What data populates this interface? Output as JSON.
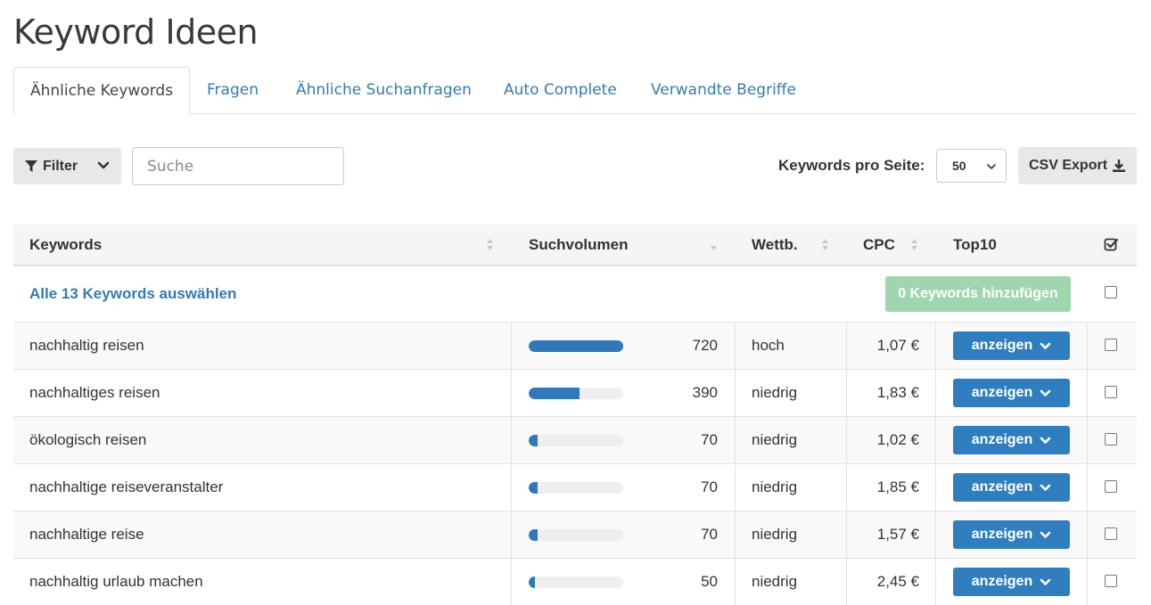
{
  "page": {
    "title": "Keyword Ideen"
  },
  "tabs": [
    {
      "label": "Ähnliche Keywords",
      "active": true
    },
    {
      "label": "Fragen"
    },
    {
      "label": "Ähnliche Suchanfragen"
    },
    {
      "label": "Auto Complete"
    },
    {
      "label": "Verwandte Begriffe"
    }
  ],
  "toolbar": {
    "filter_label": "Filter",
    "search_placeholder": "Suche",
    "per_page_label": "Keywords pro Seite:",
    "per_page_value": "50",
    "csv_label": "CSV Export"
  },
  "table": {
    "headers": {
      "keywords": "Keywords",
      "volume": "Suchvolumen",
      "competition": "Wettb.",
      "cpc": "CPC",
      "top10": "Top10"
    },
    "select_all_label": "Alle 13 Keywords auswählen",
    "add_label": "0 Keywords hinzufügen",
    "top10_button_label": "anzeigen",
    "max_volume": 720,
    "rows": [
      {
        "keyword": "nachhaltig reisen",
        "volume": "720",
        "volume_value": 720,
        "competition": "hoch",
        "cpc": "1,07 €"
      },
      {
        "keyword": "nachhaltiges reisen",
        "volume": "390",
        "volume_value": 390,
        "competition": "niedrig",
        "cpc": "1,83 €"
      },
      {
        "keyword": "ökologisch reisen",
        "volume": "70",
        "volume_value": 70,
        "competition": "niedrig",
        "cpc": "1,02 €"
      },
      {
        "keyword": "nachhaltige reiseveranstalter",
        "volume": "70",
        "volume_value": 70,
        "competition": "niedrig",
        "cpc": "1,85 €"
      },
      {
        "keyword": "nachhaltige reise",
        "volume": "70",
        "volume_value": 70,
        "competition": "niedrig",
        "cpc": "1,57 €"
      },
      {
        "keyword": "nachhaltig urlaub machen",
        "volume": "50",
        "volume_value": 50,
        "competition": "niedrig",
        "cpc": "2,45 €"
      }
    ]
  },
  "colors": {
    "link": "#337ab7",
    "primary": "#2f7fc0",
    "success_disabled": "#9fd6ae"
  },
  "icons": {
    "filter": "funnel-icon",
    "chevron": "chevron-down-icon",
    "download": "download-icon",
    "check_all": "check-square-icon"
  }
}
